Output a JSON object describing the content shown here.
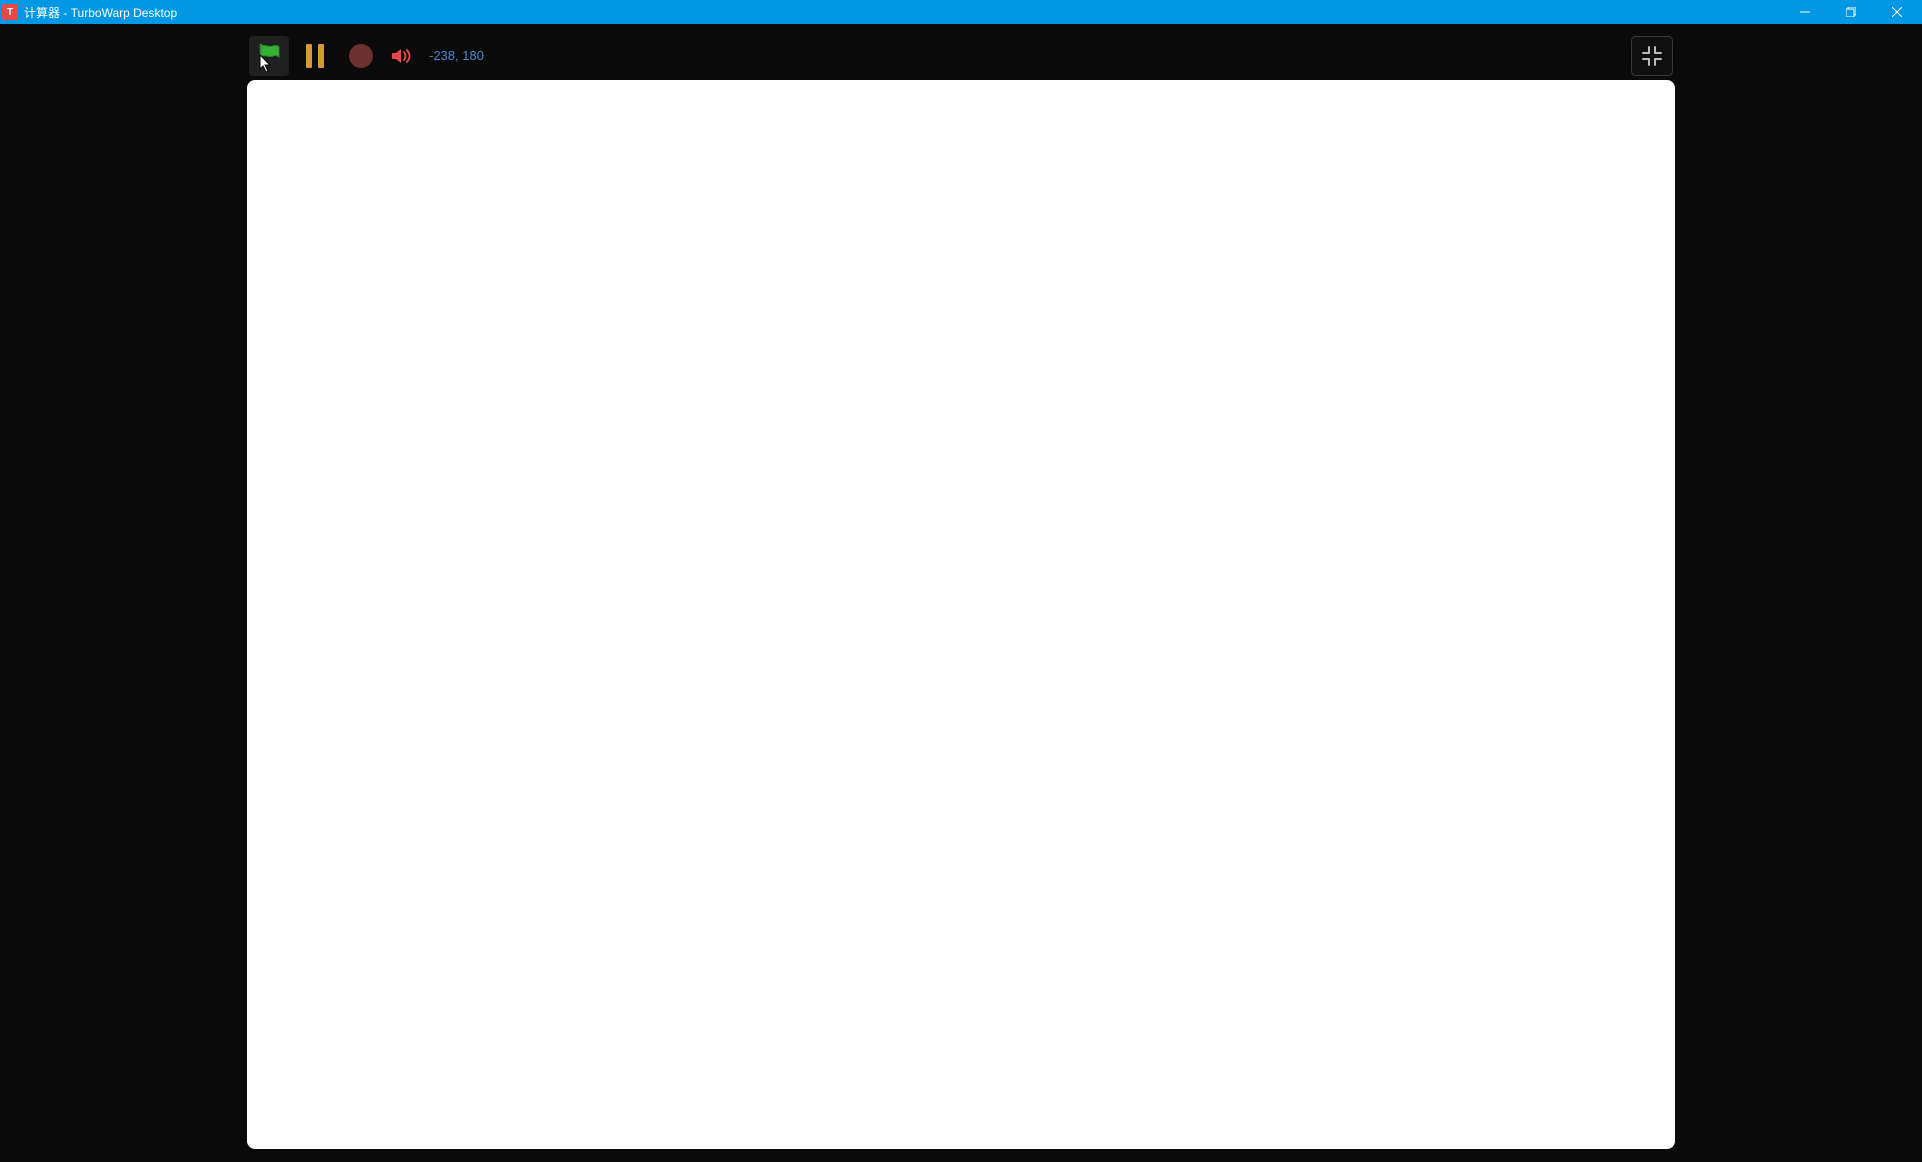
{
  "titlebar": {
    "title": "计算器 - TurboWarp Desktop",
    "icon_letter": "T"
  },
  "toolbar": {
    "coords": "-238, 180"
  }
}
